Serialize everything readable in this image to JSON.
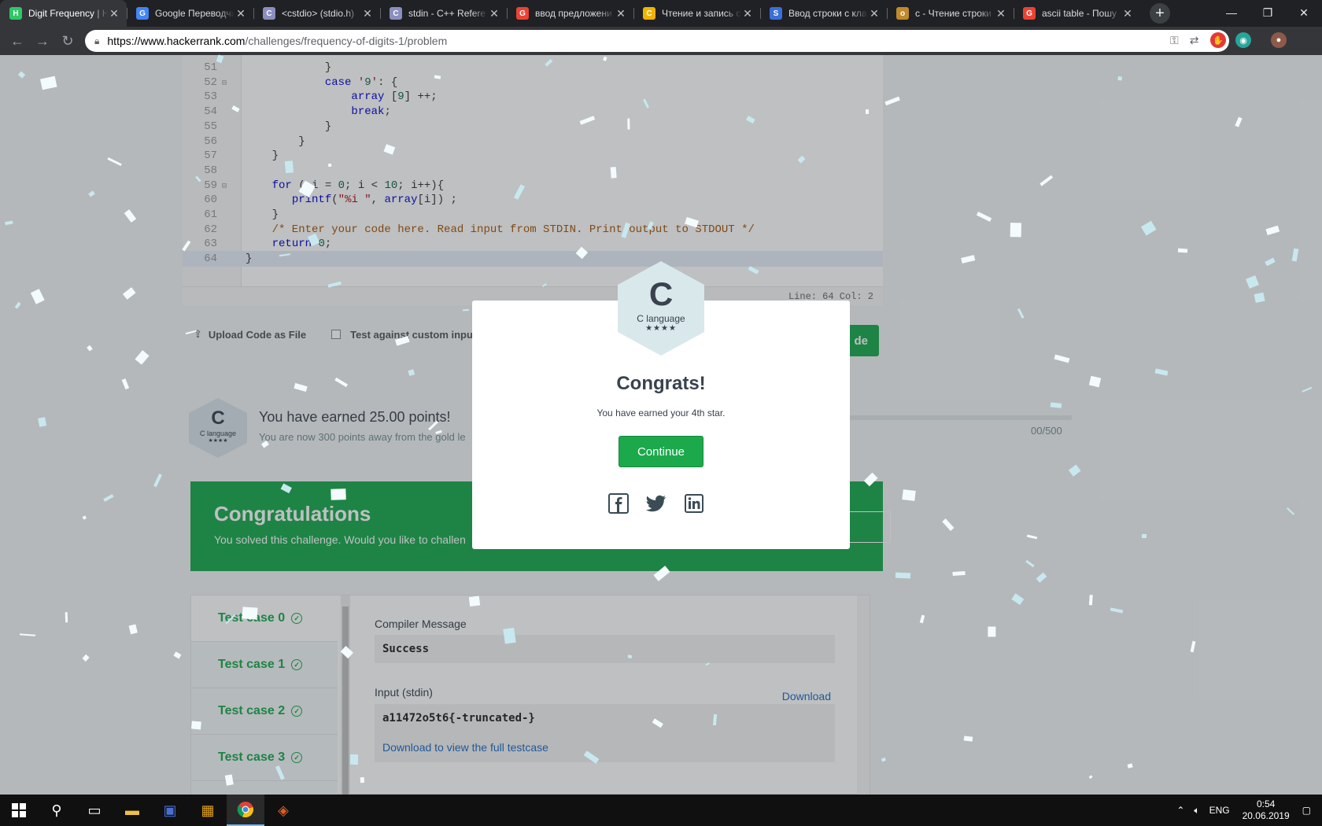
{
  "browser": {
    "tabs": [
      {
        "title": "Digit Frequency | H",
        "favicon": "hackerrank-icon",
        "fav_glyph": "H",
        "fav_color": "#2ec866",
        "active": true
      },
      {
        "title": "Google Переводчик",
        "favicon": "google-translate-icon",
        "fav_glyph": "G",
        "fav_color": "#4285f4"
      },
      {
        "title": "<cstdio> (stdio.h)",
        "favicon": "cplusplus-icon",
        "fav_glyph": "C",
        "fav_color": "#8a8fbf"
      },
      {
        "title": "stdin - C++ Refere",
        "favicon": "cplusplus-icon",
        "fav_glyph": "C",
        "fav_color": "#8a8fbf"
      },
      {
        "title": "ввод предложени",
        "favicon": "google-icon",
        "fav_glyph": "G",
        "fav_color": "#ea4335"
      },
      {
        "title": "Чтение и запись с",
        "favicon": "cpp-icon",
        "fav_glyph": "C",
        "fav_color": "#f0b400"
      },
      {
        "title": "Ввод строки с кла",
        "favicon": "sql-ru-icon",
        "fav_glyph": "S",
        "fav_color": "#3a6fd8"
      },
      {
        "title": "c - Чтение строки",
        "favicon": "glasses-icon",
        "fav_glyph": "o",
        "fav_color": "#c08a2c"
      },
      {
        "title": "ascii table - Пошу",
        "favicon": "google-icon",
        "fav_glyph": "G",
        "fav_color": "#ea4335"
      }
    ],
    "url_host": "https://www.hackerrank.com",
    "url_path": "/challenges/frequency-of-digits-1/problem"
  },
  "editor": {
    "lines": [
      {
        "n": "51",
        "fold": "",
        "code": "            }"
      },
      {
        "n": "52",
        "fold": "⊟",
        "code": "            case '9': {"
      },
      {
        "n": "53",
        "fold": "",
        "code": "                array [9] ++;"
      },
      {
        "n": "54",
        "fold": "",
        "code": "                break;"
      },
      {
        "n": "55",
        "fold": "",
        "code": "            }"
      },
      {
        "n": "56",
        "fold": "",
        "code": "        }"
      },
      {
        "n": "57",
        "fold": "",
        "code": "    }"
      },
      {
        "n": "58",
        "fold": "",
        "code": ""
      },
      {
        "n": "59",
        "fold": "⊟",
        "code": "    for ( i = 0; i < 10; i++){"
      },
      {
        "n": "60",
        "fold": "",
        "code": "       printf(\"%i \", array[i]) ;"
      },
      {
        "n": "61",
        "fold": "",
        "code": "    }"
      },
      {
        "n": "62",
        "fold": "",
        "code": "    /* Enter your code here. Read input from STDIN. Print output to STDOUT */"
      },
      {
        "n": "63",
        "fold": "",
        "code": "    return 0;"
      },
      {
        "n": "64",
        "fold": "",
        "code": "}"
      }
    ],
    "status": "Line: 64 Col: 2"
  },
  "controls": {
    "upload_label": "Upload Code as File",
    "custom_input_label": "Test against custom input",
    "submit_label": "de"
  },
  "earned": {
    "badge_letter": "C",
    "badge_name": "C language",
    "badge_stars": "★★★★",
    "title": "You have earned 25.00 points!",
    "subtitle": "You are now 300 points away from the gold le",
    "progress": "00/500"
  },
  "congrats_banner": {
    "title": "Congratulations",
    "text": "You solved this challenge. Would you like to challen"
  },
  "tests": {
    "cases": [
      {
        "label": "Test case 0",
        "selected": true
      },
      {
        "label": "Test case 1"
      },
      {
        "label": "Test case 2"
      },
      {
        "label": "Test case 3"
      }
    ],
    "compiler_label": "Compiler Message",
    "compiler_value": "Success",
    "input_label": "Input (stdin)",
    "download_label": "Download",
    "input_value": "a11472o5t6{-truncated-}",
    "full_link": "Download to view the full testcase"
  },
  "modal": {
    "badge_letter": "C",
    "badge_name": "C language",
    "badge_stars": "★★★★",
    "title": "Congrats!",
    "subtitle": "You have earned your 4th star.",
    "continue_label": "Continue"
  },
  "taskbar": {
    "lang": "ENG",
    "time": "0:54",
    "date": "20.06.2019"
  },
  "colors": {
    "accent": "#1ba94c",
    "link": "#1f6ac1",
    "text": "#39424e"
  }
}
